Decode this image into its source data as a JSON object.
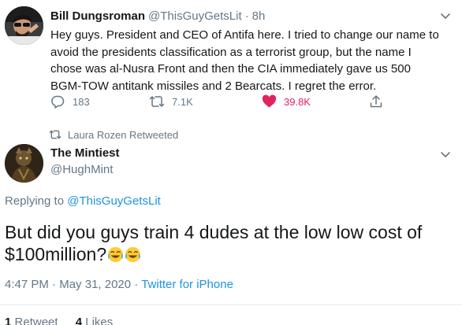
{
  "parent_tweet": {
    "display_name": "Bill Dungsroman",
    "handle": "@ThisGuyGetsLit",
    "separator": "·",
    "time": "8h",
    "text": "Hey guys. President and CEO of Antifa here. I tried to change our name to avoid the presidents classification as a terrorist group, but the name I chose was al-Nusra Front and then the CIA immediately gave us 500 BGM-TOW antitank missiles and 2 Bearcats. I regret the error.",
    "replies": "183",
    "retweets": "7.1K",
    "likes": "39.8K",
    "icons": {
      "reply": "reply-icon",
      "retweet": "retweet-icon",
      "like": "heart-icon",
      "share": "share-icon",
      "more": "chevron-down-icon"
    }
  },
  "retweeted_by": {
    "text": "Laura Rozen Retweeted",
    "icon": "retweet-icon"
  },
  "main_tweet": {
    "display_name": "The Mintiest",
    "handle": "@HughMint",
    "replying_prefix": "Replying to ",
    "replying_to": "@ThisGuyGetsLit",
    "text": "But did you guys train 4 dudes at the low low cost of $100million?",
    "emoji": "face-with-tears-of-joy",
    "emoji_count": 2,
    "time": "4:47 PM",
    "separator": "·",
    "date": "May 31, 2020",
    "source": "Twitter for iPhone",
    "retweet_count": "1",
    "retweet_label": "Retweet",
    "like_count": "4",
    "like_label": "Likes"
  },
  "colors": {
    "text": "#14171a",
    "secondary": "#657786",
    "link": "#1b95e0",
    "like": "#e0245e",
    "divider": "#e6ecf0"
  }
}
